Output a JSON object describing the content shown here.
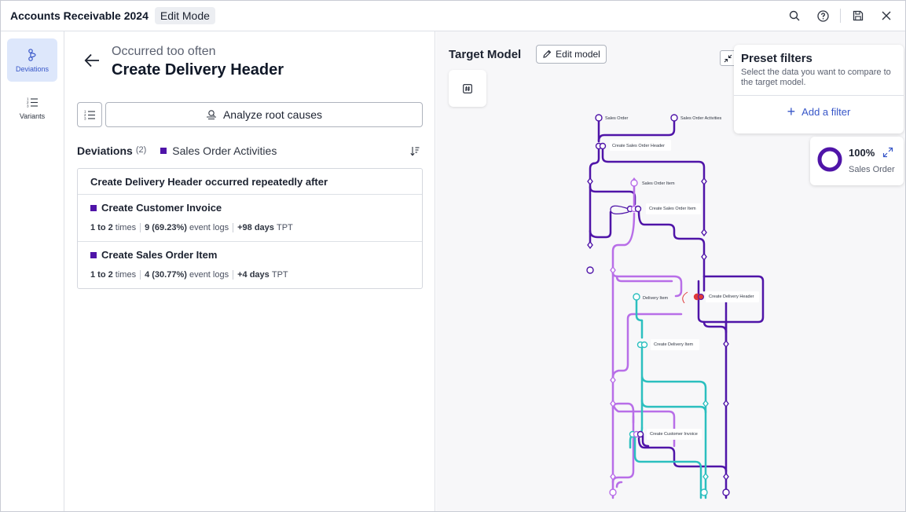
{
  "header": {
    "app_title": "Accounts Receivable 2024",
    "mode": "Edit Mode"
  },
  "rail": {
    "items": [
      {
        "label": "Deviations",
        "active": true
      },
      {
        "label": "Variants",
        "active": false
      }
    ]
  },
  "deviation": {
    "subtitle": "Occurred too often",
    "title": "Create Delivery Header",
    "analyze_label": "Analyze root causes",
    "list_label": "Deviations",
    "list_count": "(2)",
    "legend": "Sales Order Activities",
    "card_heading": "Create Delivery Header occurred repeatedly after",
    "items": [
      {
        "name": "Create Customer Invoice",
        "times": "1 to 2",
        "times_unit": "times",
        "logs": "9 (69.23%)",
        "logs_unit": "event logs",
        "tpt": "+98 days",
        "tpt_unit": "TPT"
      },
      {
        "name": "Create Sales Order Item",
        "times": "1 to 2",
        "times_unit": "times",
        "logs": "4 (30.77%)",
        "logs_unit": "event logs",
        "tpt": "+4 days",
        "tpt_unit": "TPT"
      }
    ]
  },
  "target_model": {
    "title": "Target Model",
    "edit_label": "Edit model",
    "hash_icon": "#"
  },
  "preset_filters": {
    "title": "Preset filters",
    "description": "Select the data you want to compare to the target model.",
    "add_label": "Add a filter"
  },
  "stat": {
    "value": "100%",
    "label": "Sales Order",
    "fraction": 1.0
  },
  "graph": {
    "colors": {
      "sales_order": "#4f14a8",
      "sales_order_item": "#b86ee8",
      "delivery": "#2bbfbf",
      "highlight": "#e03a3a"
    },
    "nodes": [
      {
        "id": "so",
        "label": "Sales Order"
      },
      {
        "id": "soa",
        "label": "Sales Order Activities"
      },
      {
        "id": "csoh",
        "label": "Create Sales Order Header"
      },
      {
        "id": "soi",
        "label": "Sales Order Item"
      },
      {
        "id": "csoi",
        "label": "Create Sales Order Item"
      },
      {
        "id": "di",
        "label": "Delivery Item"
      },
      {
        "id": "cdh",
        "label": "Create Delivery Header"
      },
      {
        "id": "cdi",
        "label": "Create Delivery Item"
      },
      {
        "id": "cci",
        "label": "Create Customer Invoice"
      }
    ]
  }
}
